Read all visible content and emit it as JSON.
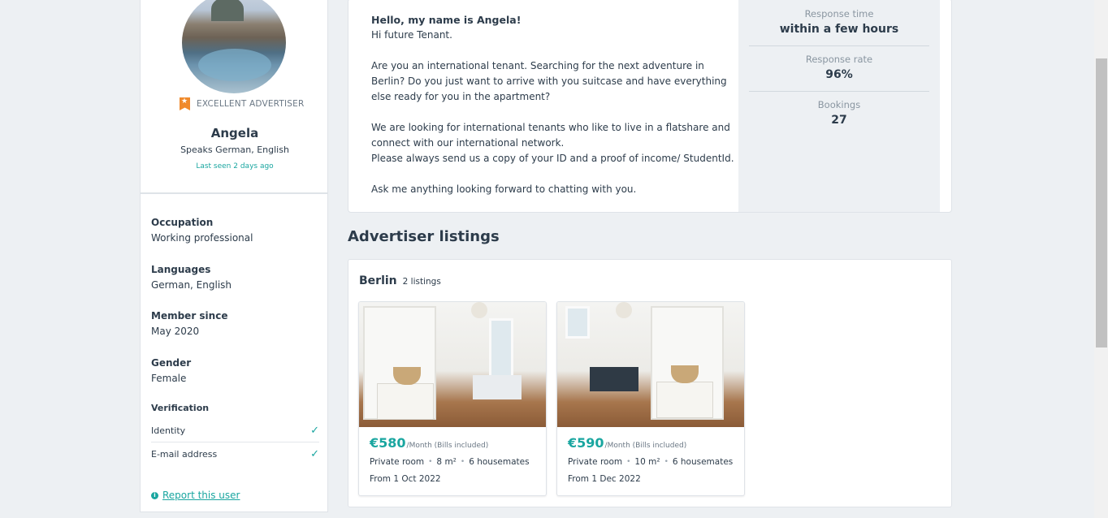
{
  "profile": {
    "badge_text": "EXCELLENT ADVERTISER",
    "name": "Angela",
    "speaks": "Speaks German, English",
    "last_seen": "Last seen 2 days ago"
  },
  "details": {
    "occupation": {
      "label": "Occupation",
      "value": "Working professional"
    },
    "languages": {
      "label": "Languages",
      "value": "German, English"
    },
    "member_since": {
      "label": "Member since",
      "value": "May 2020"
    },
    "gender": {
      "label": "Gender",
      "value": "Female"
    },
    "verification": {
      "title": "Verification",
      "items": [
        {
          "label": "Identity",
          "verified": true
        },
        {
          "label": "E-mail address",
          "verified": true
        }
      ]
    },
    "report_link": "Report this user"
  },
  "about": {
    "greeting": "Hello, my name is Angela!",
    "lines": [
      "Hi future Tenant.",
      "",
      "Are you an international tenant. Searching for the next adventure in Berlin? Do you just want to arrive with you suitcase and have everything else ready for you in the apartment?",
      "",
      "We are looking for international tenants who like to live in a flatshare and connect with our international network.",
      "Please always send us a copy of your ID and a proof of income/ StudentId.",
      "",
      "Ask me anything looking forward to chatting with you."
    ]
  },
  "stats": [
    {
      "label": "Response time",
      "value": "within a few hours"
    },
    {
      "label": "Response rate",
      "value": "96%"
    },
    {
      "label": "Bookings",
      "value": "27"
    }
  ],
  "listings_section": {
    "title": "Advertiser listings",
    "city": "Berlin",
    "count": "2 listings",
    "items": [
      {
        "price": "€580",
        "per": "/Month (Bills included)",
        "type": "Private room",
        "size": "8 m²",
        "housemates": "6 housemates",
        "from": "From 1 Oct 2022"
      },
      {
        "price": "€590",
        "per": "/Month (Bills included)",
        "type": "Private room",
        "size": "10 m²",
        "housemates": "6 housemates",
        "from": "From 1 Dec 2022"
      }
    ]
  },
  "colors": {
    "accent": "#1aa6a0",
    "badge": "#f08a2c",
    "text": "#2d3c4b",
    "background": "#edf0f3"
  },
  "icons": {
    "badge": "ribbon-star-icon",
    "check": "check-icon",
    "info": "info-icon"
  }
}
